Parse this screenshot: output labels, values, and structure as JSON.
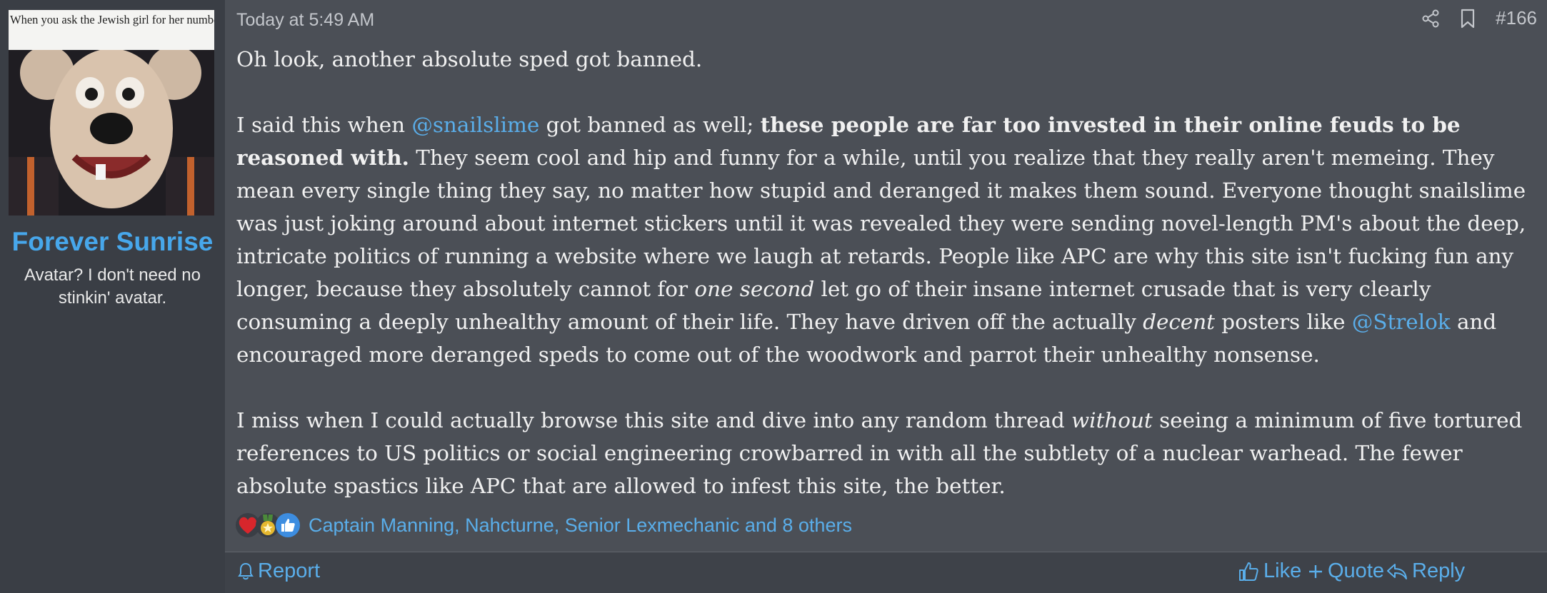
{
  "user": {
    "avatar_caption": "When you ask the Jewish girl for her number and she starts rolling up her sleeve",
    "name": "Forever Sunrise",
    "title": "Avatar? I don't need no stinkin' avatar."
  },
  "post": {
    "timestamp": "Today at 5:49 AM",
    "number": "#166",
    "paragraph1": "Oh look, another absolute sped got banned.",
    "p2": {
      "a": "I said this when ",
      "mention1": "@snailslime",
      "b": " got banned as well; ",
      "bold": "these people are far too invested in their online feuds to be reasoned with.",
      "c": " They seem cool and hip and funny for a while, until you realize that they really aren't memeing. They mean every single thing they say, no matter how stupid and deranged it makes them sound. Everyone thought snailslime was just joking around about internet stickers until it was revealed they were sending novel-length PM's about the deep, intricate politics of running a website where we laugh at retards. People like APC are why this site isn't fucking fun any longer, because they absolutely cannot for ",
      "italic1": "one second",
      "d": " let go of their insane internet crusade that is very clearly consuming a deeply unhealthy amount of their life. They have driven off the actually ",
      "italic2": "decent",
      "e": " posters like ",
      "mention2": "@Strelok",
      "f": " and encouraged more deranged speds to come out of the woodwork and parrot their unhealthy nonsense."
    },
    "p3": {
      "a": "I miss when I could actually browse this site and dive into any random thread ",
      "italic": "without",
      "b": " seeing a minimum of five tortured references to US politics or social engineering crowbarred in with all the subtlety of a nuclear warhead. The fewer absolute spastics like APC that are allowed to infest this site, the better."
    }
  },
  "reactions": {
    "icons": [
      "heart-reaction-icon",
      "medal-reaction-icon",
      "thumbs-up-reaction-icon"
    ],
    "users_text": "Captain Manning, Nahcturne, Senior Lexmechanic and 8 others"
  },
  "footer": {
    "report": "Report",
    "like": "Like",
    "quote": "Quote",
    "reply": "Reply"
  },
  "colors": {
    "link": "#5aaeea",
    "username": "#47a7eb",
    "post_bg": "#4b4f56",
    "sidebar_bg": "#3a3e45"
  }
}
